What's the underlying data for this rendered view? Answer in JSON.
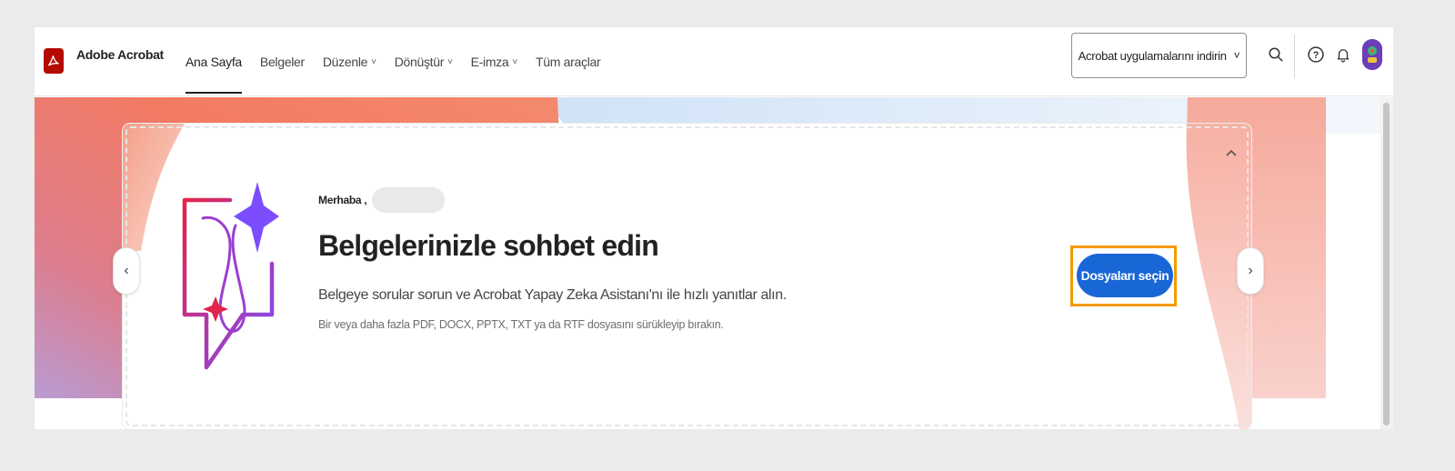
{
  "app": {
    "brand": "Adobe Acrobat"
  },
  "nav": {
    "items": [
      {
        "label": "Ana Sayfa",
        "chevron": ""
      },
      {
        "label": "Belgeler",
        "chevron": ""
      },
      {
        "label": "Düzenle",
        "chevron": "˅"
      },
      {
        "label": "Dönüştür",
        "chevron": "˅"
      },
      {
        "label": "E-imza",
        "chevron": "˅"
      },
      {
        "label": "Tüm araçlar",
        "chevron": ""
      }
    ]
  },
  "header": {
    "download_label": "Acrobat uygulamalarını indirin",
    "download_chevron": "˅",
    "help_glyph": "?"
  },
  "hero": {
    "greeting": "Merhaba ,",
    "title": "Belgelerinizle sohbet edin",
    "description": "Belgeye sorular sorun ve Acrobat Yapay Zeka Asistanı'nı ile hızlı yanıtlar alın.",
    "subtext": "Bir veya daha fazla PDF, DOCX, PPTX, TXT ya da RTF dosyasını sürükleyip bırakın.",
    "cta_label": "Dosyaları seçin",
    "prev_glyph": "‹",
    "next_glyph": "›"
  },
  "colors": {
    "acrobat_red": "#b30b00",
    "primary_blue": "#1966d7",
    "focus_orange": "#f59a00",
    "sparkle_purple": "#7b4dff"
  }
}
